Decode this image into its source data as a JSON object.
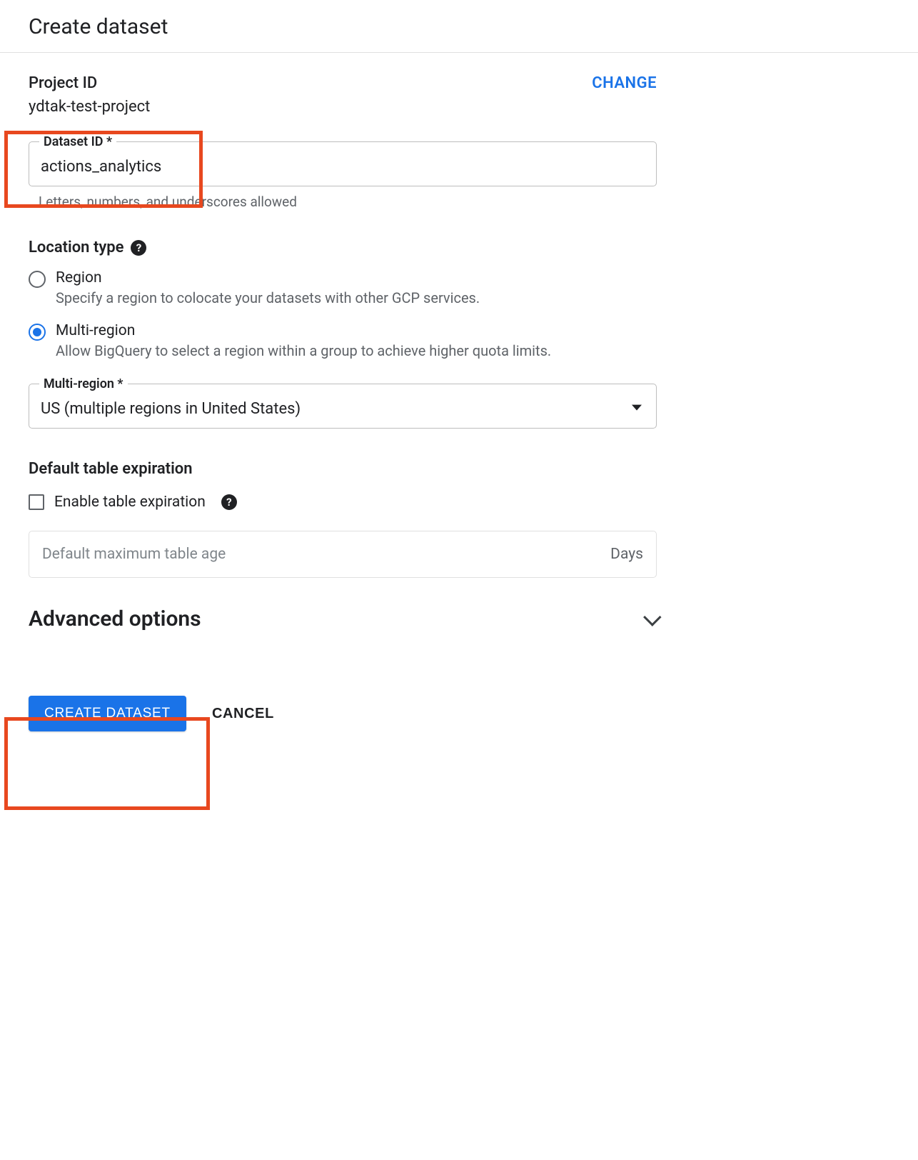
{
  "page_title": "Create dataset",
  "project": {
    "label": "Project ID",
    "value": "ydtak-test-project",
    "change": "CHANGE"
  },
  "dataset_id": {
    "label": "Dataset ID *",
    "value": "actions_analytics",
    "helper": "Letters, numbers, and underscores allowed"
  },
  "location": {
    "title": "Location type",
    "options": [
      {
        "label": "Region",
        "desc": "Specify a region to colocate your datasets with other GCP services.",
        "selected": false
      },
      {
        "label": "Multi-region",
        "desc": "Allow BigQuery to select a region within a group to achieve higher quota limits.",
        "selected": true
      }
    ]
  },
  "multi_region": {
    "label": "Multi-region *",
    "value": "US (multiple regions in United States)"
  },
  "expiration": {
    "title": "Default table expiration",
    "checkbox_label": "Enable table expiration",
    "max_age_label": "Default maximum table age",
    "max_age_suffix": "Days"
  },
  "advanced": {
    "title": "Advanced options"
  },
  "buttons": {
    "create": "CREATE DATASET",
    "cancel": "CANCEL"
  }
}
